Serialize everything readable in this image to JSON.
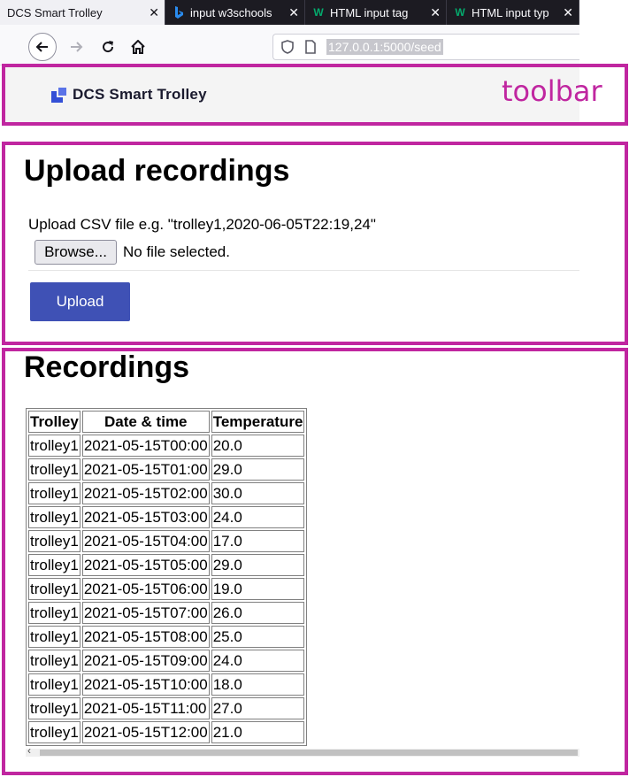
{
  "browser": {
    "tabs": [
      {
        "title": "DCS Smart Trolley",
        "active": true,
        "icon": "none"
      },
      {
        "title": "input w3schools",
        "active": false,
        "icon": "bing-icon"
      },
      {
        "title": "HTML input tag",
        "active": false,
        "icon": "w3schools-icon"
      },
      {
        "title": "HTML input typ",
        "active": false,
        "icon": "w3schools-icon"
      }
    ],
    "close_glyph": "✕",
    "url": "127.0.0.1:5000/seed"
  },
  "annotations": {
    "toolbar_label": "toolbar",
    "color": "#c026a0"
  },
  "toolbar": {
    "brand": "DCS Smart Trolley"
  },
  "upload": {
    "heading": "Upload recordings",
    "hint": "Upload CSV file e.g. \"trolley1,2020-06-05T22:19,24\"",
    "browse_label": "Browse...",
    "file_status": "No file selected.",
    "submit_label": "Upload",
    "accent": "#3f51b5"
  },
  "recordings": {
    "heading": "Recordings",
    "columns": [
      "Trolley",
      "Date & time",
      "Temperature"
    ],
    "rows": [
      [
        "trolley1",
        "2021-05-15T00:00",
        "20.0"
      ],
      [
        "trolley1",
        "2021-05-15T01:00",
        "29.0"
      ],
      [
        "trolley1",
        "2021-05-15T02:00",
        "30.0"
      ],
      [
        "trolley1",
        "2021-05-15T03:00",
        "24.0"
      ],
      [
        "trolley1",
        "2021-05-15T04:00",
        "17.0"
      ],
      [
        "trolley1",
        "2021-05-15T05:00",
        "29.0"
      ],
      [
        "trolley1",
        "2021-05-15T06:00",
        "19.0"
      ],
      [
        "trolley1",
        "2021-05-15T07:00",
        "26.0"
      ],
      [
        "trolley1",
        "2021-05-15T08:00",
        "25.0"
      ],
      [
        "trolley1",
        "2021-05-15T09:00",
        "24.0"
      ],
      [
        "trolley1",
        "2021-05-15T10:00",
        "18.0"
      ],
      [
        "trolley1",
        "2021-05-15T11:00",
        "27.0"
      ],
      [
        "trolley1",
        "2021-05-15T12:00",
        "21.0"
      ]
    ]
  }
}
